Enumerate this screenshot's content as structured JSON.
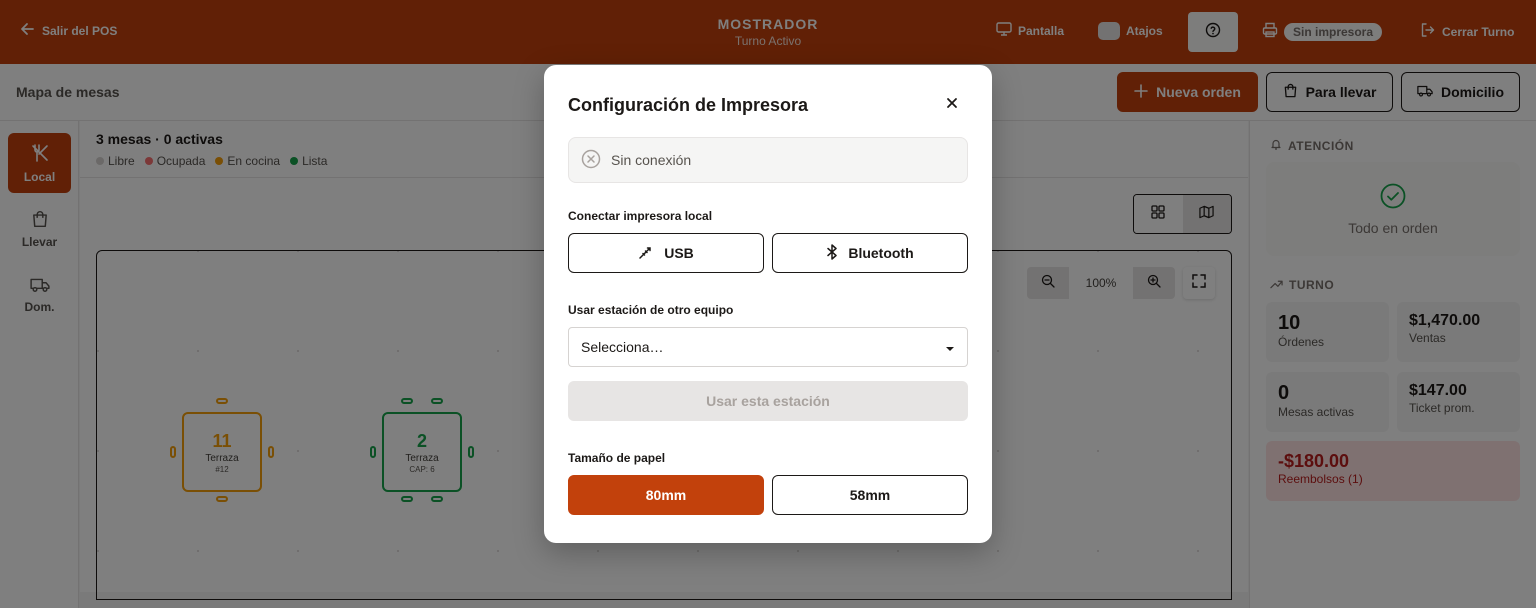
{
  "topbar": {
    "back_label": "Salir del POS",
    "title": "MOSTRADOR",
    "subtitle": "Turno Activo",
    "pantalla_label": "Pantalla",
    "atajos_label": "Atajos",
    "printer_badge": "Sin impresora",
    "cerrar_label": "Cerrar Turno"
  },
  "subheader": {
    "title": "Mapa de mesas",
    "nueva_orden": "Nueva orden",
    "para_llevar": "Para llevar",
    "domicilio": "Domicilio"
  },
  "leftnav": {
    "items": [
      {
        "label": "Local",
        "icon": "utensils-icon",
        "active": true
      },
      {
        "label": "Llevar",
        "icon": "bag-icon",
        "active": false
      },
      {
        "label": "Dom.",
        "icon": "truck-icon",
        "active": false
      }
    ]
  },
  "main": {
    "count_text": "3 mesas · 0 activas",
    "legend": [
      {
        "label": "Libre",
        "color": "#d6d3d1"
      },
      {
        "label": "Ocupada",
        "color": "#f87171"
      },
      {
        "label": "En cocina",
        "color": "#f59e0b"
      },
      {
        "label": "Lista",
        "color": "#16a34a"
      }
    ],
    "zoom": "100%",
    "tables": [
      {
        "number": "11",
        "zone": "Terraza",
        "extra": "#12",
        "color": "#f59e0b"
      },
      {
        "number": "2",
        "zone": "Terraza",
        "extra": "CAP: 6",
        "color": "#16a34a"
      }
    ]
  },
  "rightpanel": {
    "attention_title": "ATENCIÓN",
    "attention_text": "Todo en orden",
    "turno_title": "TURNO",
    "ordenes_value": "10",
    "ordenes_label": "Órdenes",
    "ventas_value": "$1,470.00",
    "ventas_label": "Ventas",
    "mesas_value": "0",
    "mesas_label": "Mesas activas",
    "ticket_value": "$147.00",
    "ticket_label": "Ticket prom.",
    "refund_value": "-$180.00",
    "refund_label": "Reembolsos (1)"
  },
  "modal": {
    "title": "Configuración de Impresora",
    "status": "Sin conexión",
    "connect_label": "Conectar impresora local",
    "usb_label": "USB",
    "bluetooth_label": "Bluetooth",
    "station_label": "Usar estación de otro equipo",
    "select_placeholder": "Selecciona…",
    "use_station_button": "Usar esta estación",
    "paper_label": "Tamaño de papel",
    "paper_80": "80mm",
    "paper_58": "58mm",
    "selected_paper": "80mm",
    "accent_color": "#c2410c"
  }
}
